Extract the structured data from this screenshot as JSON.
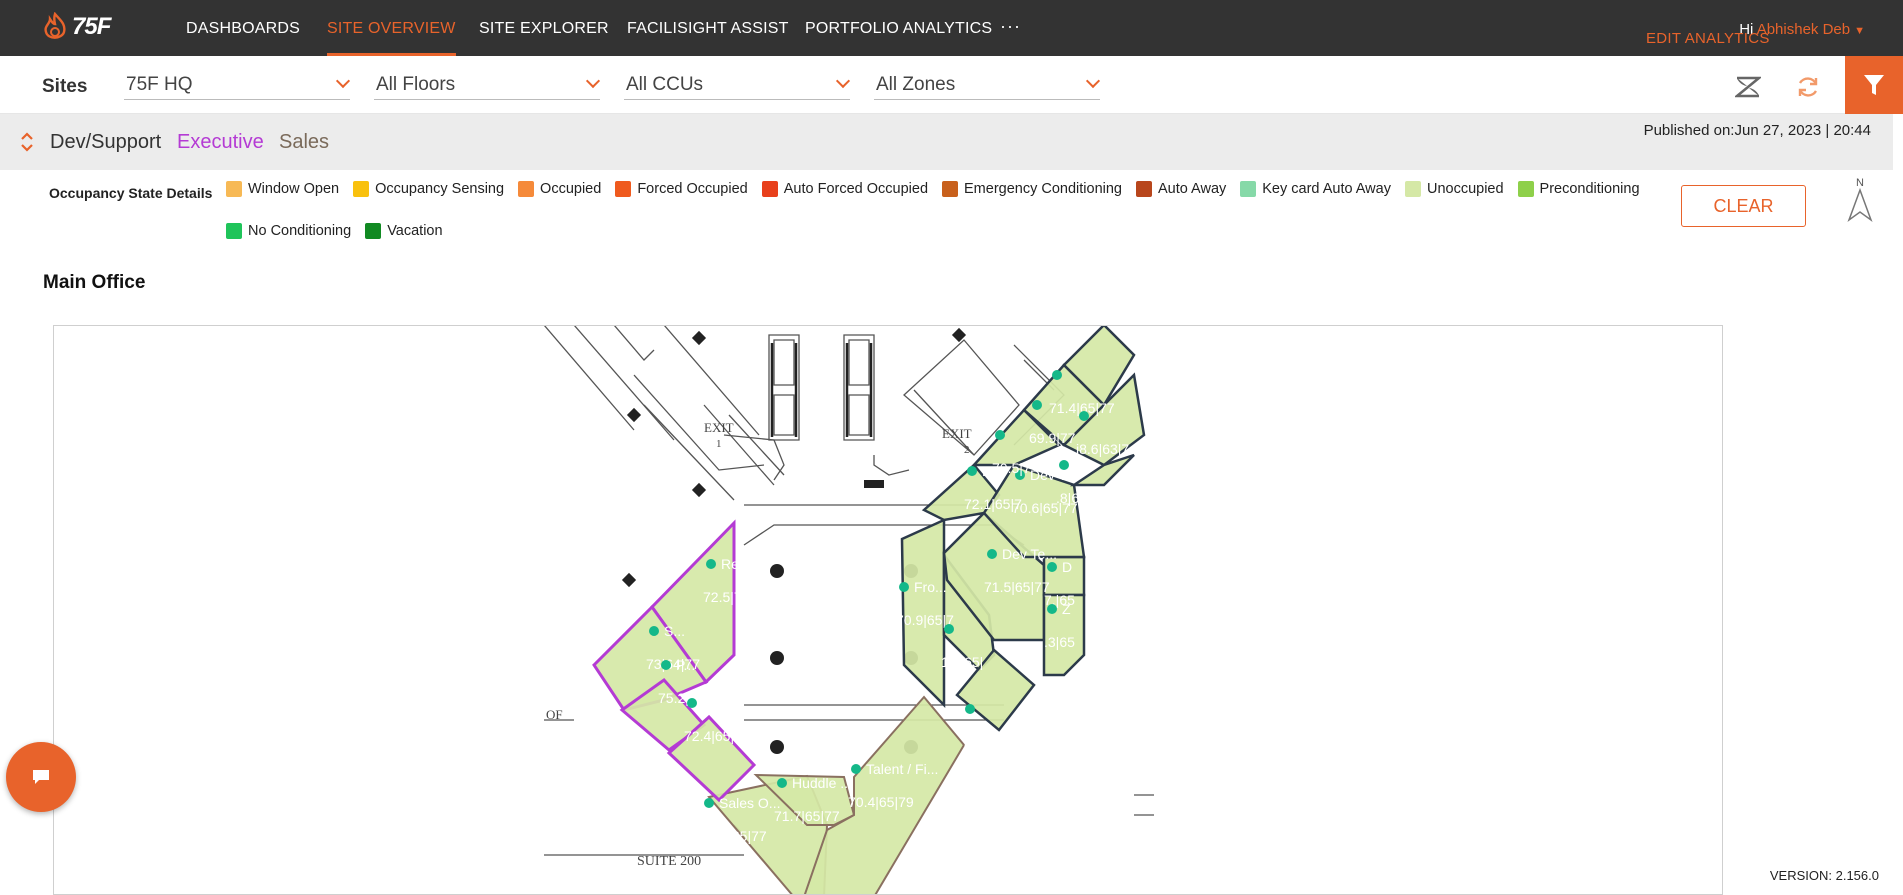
{
  "app": {
    "logo_text": "75F",
    "nav": [
      {
        "label": "DASHBOARDS",
        "active": false
      },
      {
        "label": "SITE OVERVIEW",
        "active": true
      },
      {
        "label": "SITE EXPLORER",
        "active": false
      },
      {
        "label": "FACILISIGHT ASSIST",
        "active": false
      },
      {
        "label": "PORTFOLIO ANALYTICS",
        "active": false
      }
    ],
    "more_label": "···",
    "greeting": "Hi",
    "user_name": "Abhishek Deb",
    "accent_color": "#e8632b"
  },
  "filters": {
    "sites_label": "Sites",
    "site": "75F HQ",
    "floor": "All Floors",
    "ccu": "All CCUs",
    "zone": "All Zones"
  },
  "subheader": {
    "tabs": [
      {
        "label": "Dev/Support",
        "color": "#333333"
      },
      {
        "label": "Executive",
        "color": "#b43bd4"
      },
      {
        "label": "Sales",
        "color": "#7a6a5a"
      }
    ],
    "published": "Published on:Jun 27, 2023 | 20:44",
    "edit_analytics": "EDIT ANALYTICS"
  },
  "legend": {
    "title": "Occupancy State Details",
    "items": [
      {
        "label": "Window Open",
        "color": "#f7b955"
      },
      {
        "label": "Occupancy Sensing",
        "color": "#f9c10e"
      },
      {
        "label": "Occupied",
        "color": "#f58a3a"
      },
      {
        "label": "Forced Occupied",
        "color": "#ef5a1e"
      },
      {
        "label": "Auto Forced Occupied",
        "color": "#e8401c"
      },
      {
        "label": "Emergency Conditioning",
        "color": "#c8601c"
      },
      {
        "label": "Auto Away",
        "color": "#b8461c"
      },
      {
        "label": "Key card Auto Away",
        "color": "#86d9a8"
      },
      {
        "label": "Unoccupied",
        "color": "#d5e8a6"
      },
      {
        "label": "Preconditioning",
        "color": "#8ed04a"
      },
      {
        "label": "No Conditioning",
        "color": "#1fc45a"
      },
      {
        "label": "Vacation",
        "color": "#118a22"
      }
    ],
    "clear_label": "CLEAR"
  },
  "floor": {
    "title": "Main Office",
    "plan_text": {
      "exit1": "EXIT",
      "exit1_num": "1",
      "exit2": "EXIT",
      "exit2_num": "2",
      "of": "OF",
      "suite": "SUITE 200"
    },
    "zones": [
      {
        "name": "Rec...",
        "temps": "72.5|77"
      },
      {
        "name": "S...",
        "temps": "73|64|77"
      },
      {
        "name": "P...",
        "temps": "75.2|65|77"
      },
      {
        "name": "E...",
        "temps": "72.4|65|77"
      },
      {
        "name": "Sales O...",
        "temps": "70.5|65|77"
      },
      {
        "name": "Huddle ...",
        "temps": "71.7|65|77"
      },
      {
        "name": "Talent / Fi...",
        "temps": "70.4|65|79"
      },
      {
        "name": "Fro...",
        "temps": "70.9|65|7"
      },
      {
        "name": "",
        "temps": "1.3|65|"
      },
      {
        "name": "",
        "temps": "72|65|7"
      },
      {
        "name": "Dev Te...",
        "temps": "71.5|65|77"
      },
      {
        "name": "D",
        "temps": "7.|65"
      },
      {
        "name": "Z",
        "temps": ".3|65"
      },
      {
        "name": "B...",
        "temps": "72.1|65|7"
      },
      {
        "name": "Dev T...",
        "temps": "70.6|65|77"
      },
      {
        "name": "",
        "temps": "70.5|7"
      },
      {
        "name": "",
        "temps": "69.9|77"
      },
      {
        "name": "",
        "temps": "71.4|65|77"
      },
      {
        "name": "",
        "temps": "i8.6|63|7"
      },
      {
        "name": "",
        "temps": ".8|65"
      }
    ],
    "unoccupied_color": "#d5e8a6",
    "executive_border": "#b43bd4",
    "sales_border": "#8a7060",
    "dev_border": "#2c3a4a",
    "sensor_dot": "#14b889"
  },
  "version": "VERSION: 2.156.0"
}
